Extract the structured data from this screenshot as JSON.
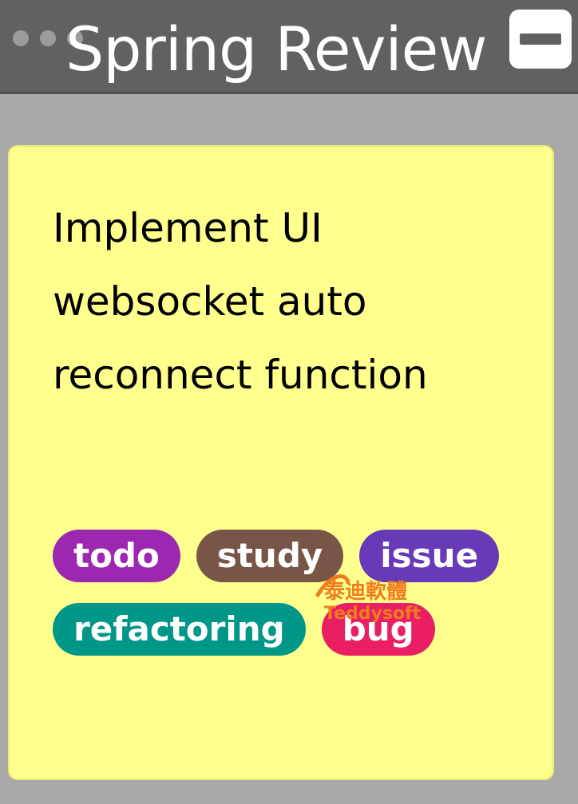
{
  "header": {
    "title": "Spring Review",
    "background": "#616161",
    "collapse_icon": "minus-icon",
    "drag_icon": "drag-handle-icon"
  },
  "card": {
    "text": "Implement UI websocket auto reconnect function",
    "background": "#ffff8d",
    "tags": [
      {
        "label": "todo",
        "color": "#9c27b0"
      },
      {
        "label": "study",
        "color": "#795548"
      },
      {
        "label": "issue",
        "color": "#673ab7"
      },
      {
        "label": "refactoring",
        "color": "#009688"
      },
      {
        "label": "bug",
        "color": "#e91e63"
      }
    ]
  },
  "watermark": {
    "line1": "泰迪軟體",
    "line2": "Teddysoft",
    "color": "#f07c1e"
  }
}
